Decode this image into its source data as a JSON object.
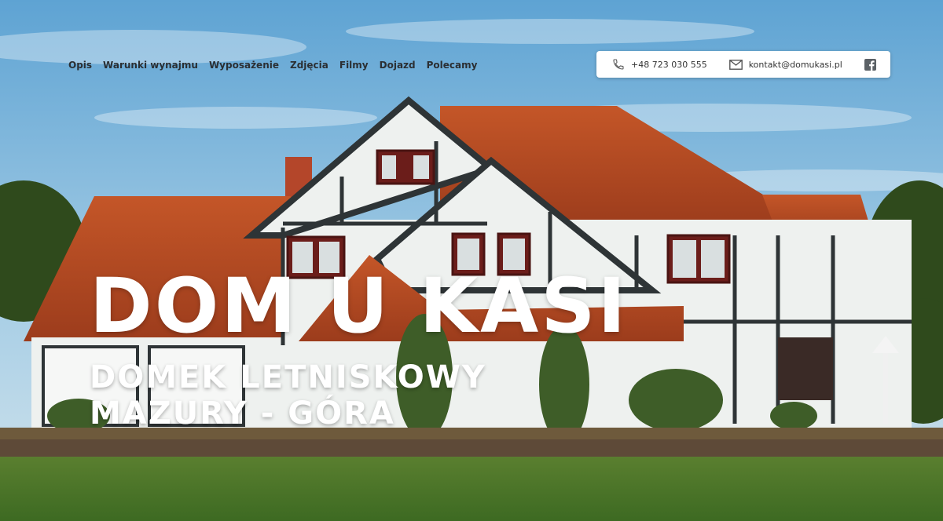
{
  "nav": {
    "items": [
      {
        "label": "Opis"
      },
      {
        "label": "Warunki wynajmu"
      },
      {
        "label": "Wyposażenie"
      },
      {
        "label": "Zdjęcia"
      },
      {
        "label": "Filmy"
      },
      {
        "label": "Dojazd"
      },
      {
        "label": "Polecamy"
      }
    ]
  },
  "contact": {
    "phone": "+48 723 030 555",
    "email": "kontakt@domukasi.pl",
    "phone_icon": "phone-icon",
    "email_icon": "envelope-icon",
    "social_icon": "facebook-icon"
  },
  "hero": {
    "title": "DOM U KASI",
    "subtitle_line1": "DOMEK LETNISKOWY",
    "subtitle_line2": "MAZURY - GÓRA",
    "image": "photo of a half-timbered house with red tiled roof under blue sky"
  },
  "colors": {
    "sky": "#6fb0d8",
    "roof": "#b84a22",
    "walls": "#f2f4f2",
    "timber": "#2e3436",
    "lawn": "#4f7a2a",
    "nav_text": "#2b2f33",
    "title_text": "#ffffff"
  }
}
